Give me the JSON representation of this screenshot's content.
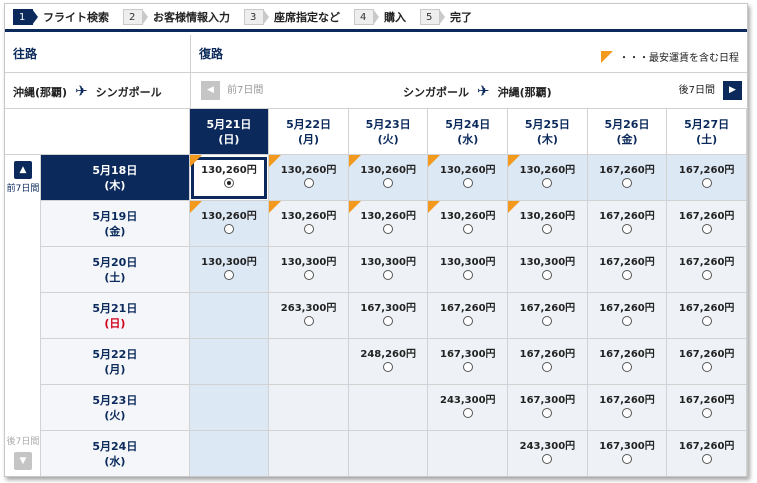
{
  "steps": [
    {
      "num": "1",
      "label": "フライト検索",
      "active": true
    },
    {
      "num": "2",
      "label": "お客様情報入力",
      "active": false
    },
    {
      "num": "3",
      "label": "座席指定など",
      "active": false
    },
    {
      "num": "4",
      "label": "購入",
      "active": false
    },
    {
      "num": "5",
      "label": "完了",
      "active": false
    }
  ],
  "outbound": {
    "title": "往路",
    "from": "沖縄(那覇)",
    "to": "シンガポール"
  },
  "return": {
    "title": "復路",
    "from": "シンガポール",
    "to": "沖縄(那覇)",
    "prev_label": "前7日間",
    "next_label": "後7日間"
  },
  "legend": {
    "text": "・・・最安運賃を含む日程",
    "color": "#f39a1e"
  },
  "side": {
    "up_label": "前7日間",
    "down_label": "後7日間"
  },
  "colors": {
    "navy": "#0b2a5b",
    "flag": "#f39a1e",
    "sunday": "#d0021b"
  },
  "columns": [
    {
      "date": "5月21日",
      "dow": "(日)",
      "selected": true
    },
    {
      "date": "5月22日",
      "dow": "(月)",
      "selected": false
    },
    {
      "date": "5月23日",
      "dow": "(火)",
      "selected": false
    },
    {
      "date": "5月24日",
      "dow": "(水)",
      "selected": false
    },
    {
      "date": "5月25日",
      "dow": "(木)",
      "selected": false
    },
    {
      "date": "5月26日",
      "dow": "(金)",
      "selected": false
    },
    {
      "date": "5月27日",
      "dow": "(土)",
      "selected": false
    }
  ],
  "rows": [
    {
      "date": "5月18日",
      "dow": "(木)",
      "selected": true,
      "sunday": false,
      "cells": [
        {
          "price": "130,260円",
          "flag": true,
          "checked": true
        },
        {
          "price": "130,260円",
          "flag": true
        },
        {
          "price": "130,260円",
          "flag": true
        },
        {
          "price": "130,260円",
          "flag": true
        },
        {
          "price": "130,260円",
          "flag": true
        },
        {
          "price": "167,260円",
          "flag": false
        },
        {
          "price": "167,260円",
          "flag": false
        }
      ]
    },
    {
      "date": "5月19日",
      "dow": "(金)",
      "selected": false,
      "sunday": false,
      "cells": [
        {
          "price": "130,260円",
          "flag": true
        },
        {
          "price": "130,260円",
          "flag": true
        },
        {
          "price": "130,260円",
          "flag": true
        },
        {
          "price": "130,260円",
          "flag": true
        },
        {
          "price": "130,260円",
          "flag": true
        },
        {
          "price": "167,260円",
          "flag": false
        },
        {
          "price": "167,260円",
          "flag": false
        }
      ]
    },
    {
      "date": "5月20日",
      "dow": "(土)",
      "selected": false,
      "sunday": false,
      "cells": [
        {
          "price": "130,300円",
          "flag": false
        },
        {
          "price": "130,300円",
          "flag": false
        },
        {
          "price": "130,300円",
          "flag": false
        },
        {
          "price": "130,300円",
          "flag": false
        },
        {
          "price": "130,300円",
          "flag": false
        },
        {
          "price": "167,260円",
          "flag": false
        },
        {
          "price": "167,260円",
          "flag": false
        }
      ]
    },
    {
      "date": "5月21日",
      "dow": "(日)",
      "selected": false,
      "sunday": true,
      "cells": [
        null,
        {
          "price": "263,300円",
          "flag": false
        },
        {
          "price": "167,300円",
          "flag": false
        },
        {
          "price": "167,260円",
          "flag": false
        },
        {
          "price": "167,260円",
          "flag": false
        },
        {
          "price": "167,260円",
          "flag": false
        },
        {
          "price": "167,260円",
          "flag": false
        }
      ]
    },
    {
      "date": "5月22日",
      "dow": "(月)",
      "selected": false,
      "sunday": false,
      "cells": [
        null,
        null,
        {
          "price": "248,260円",
          "flag": false
        },
        {
          "price": "167,300円",
          "flag": false
        },
        {
          "price": "167,260円",
          "flag": false
        },
        {
          "price": "167,260円",
          "flag": false
        },
        {
          "price": "167,260円",
          "flag": false
        }
      ]
    },
    {
      "date": "5月23日",
      "dow": "(火)",
      "selected": false,
      "sunday": false,
      "cells": [
        null,
        null,
        null,
        {
          "price": "243,300円",
          "flag": false
        },
        {
          "price": "167,300円",
          "flag": false
        },
        {
          "price": "167,260円",
          "flag": false
        },
        {
          "price": "167,260円",
          "flag": false
        }
      ]
    },
    {
      "date": "5月24日",
      "dow": "(水)",
      "selected": false,
      "sunday": false,
      "cells": [
        null,
        null,
        null,
        null,
        {
          "price": "243,300円",
          "flag": false
        },
        {
          "price": "167,300円",
          "flag": false
        },
        {
          "price": "167,260円",
          "flag": false
        }
      ]
    }
  ]
}
